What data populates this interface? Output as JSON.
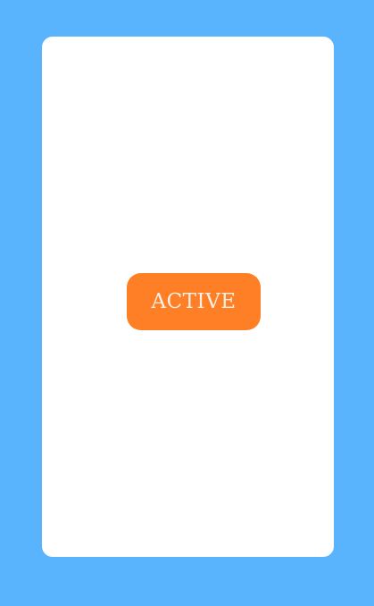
{
  "colors": {
    "background": "#5ab4fd",
    "card": "#ffffff",
    "button": "#fe7f25",
    "button_text": "#f8efe6"
  },
  "button": {
    "label": "ACTIVE"
  }
}
